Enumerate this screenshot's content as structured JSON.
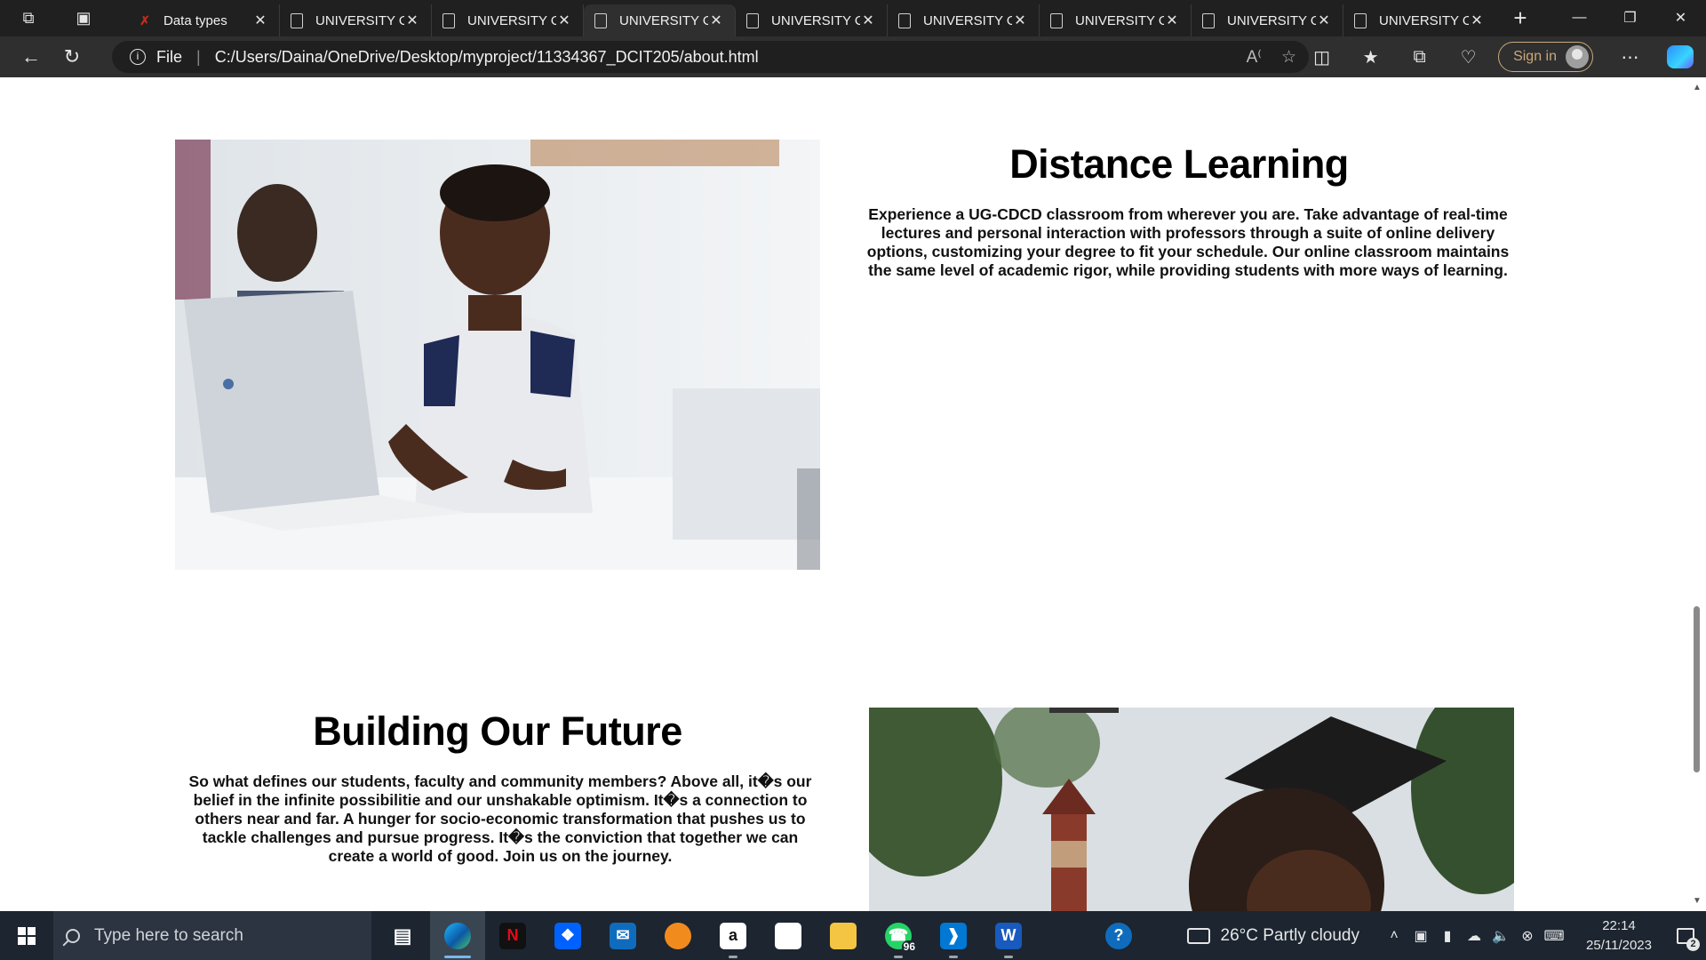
{
  "browser": {
    "tabs": [
      {
        "title": "Data types",
        "icon": "x-favicon-icon",
        "active": false
      },
      {
        "title": "UNIVERSITY OF GHANA",
        "icon": "page-icon",
        "active": false
      },
      {
        "title": "UNIVERSITY OF GHANA",
        "icon": "page-icon",
        "active": false
      },
      {
        "title": "UNIVERSITY OF GHANA",
        "icon": "page-icon",
        "active": true
      },
      {
        "title": "UNIVERSITY OF GHANA",
        "icon": "page-icon",
        "active": false
      },
      {
        "title": "UNIVERSITY OF GHANA",
        "icon": "page-icon",
        "active": false
      },
      {
        "title": "UNIVERSITY OF GHANA",
        "icon": "page-icon",
        "active": false
      },
      {
        "title": "UNIVERSITY OF GHANA",
        "icon": "page-icon",
        "active": false
      },
      {
        "title": "UNIVERSITY OF GHANA",
        "icon": "page-icon",
        "active": false
      }
    ],
    "address": {
      "scheme_label": "File",
      "url": "C:/Users/Daina/OneDrive/Desktop/myproject/11334367_DCIT205/about.html"
    },
    "signin_label": "Sign in"
  },
  "page": {
    "section1": {
      "title": "Distance Learning",
      "text": "Experience a UG-CDCD classroom from wherever you are. Take advantage of real-time lectures and personal interaction with professors through a suite of online delivery options, customizing your degree to fit your schedule. Our online classroom maintains the same level of academic rigor, while providing students with more ways of learning."
    },
    "section2": {
      "title": "Building Our Future",
      "text": "So what defines our students, faculty and community members? Above all, it�s our belief in the infinite possibilitie and our unshakable optimism. It�s a connection to others near and far. A hunger for socio-economic transformation that pushes us to tackle challenges and pursue progress. It�s the conviction that together we can create a world of good. Join us on the journey."
    },
    "scroll_fraction": 0.63
  },
  "taskbar": {
    "search_placeholder": "Type here to search",
    "apps": [
      {
        "name": "task-view-icon",
        "active": false
      },
      {
        "name": "edge-icon",
        "active": true
      },
      {
        "name": "netflix-icon",
        "active": false
      },
      {
        "name": "dropbox-icon",
        "active": false
      },
      {
        "name": "mail-icon",
        "active": false
      },
      {
        "name": "fl-studio-icon",
        "active": false
      },
      {
        "name": "amazon-icon",
        "active": false
      },
      {
        "name": "store-icon",
        "active": false
      },
      {
        "name": "file-explorer-icon",
        "active": false
      },
      {
        "name": "whatsapp-icon",
        "active": false,
        "badge": "96"
      },
      {
        "name": "vscode-icon",
        "active": false
      },
      {
        "name": "word-icon",
        "active": false
      },
      {
        "name": "help-icon",
        "active": false
      }
    ],
    "weather": "26°C  Partly cloudy",
    "time": "22:14",
    "date": "25/11/2023",
    "notification_count": "2"
  },
  "colors": {
    "titlebar": "#202020",
    "addressbar": "#2f2f2f",
    "taskbar": "#1c2530",
    "accent": "#76b9ed"
  }
}
